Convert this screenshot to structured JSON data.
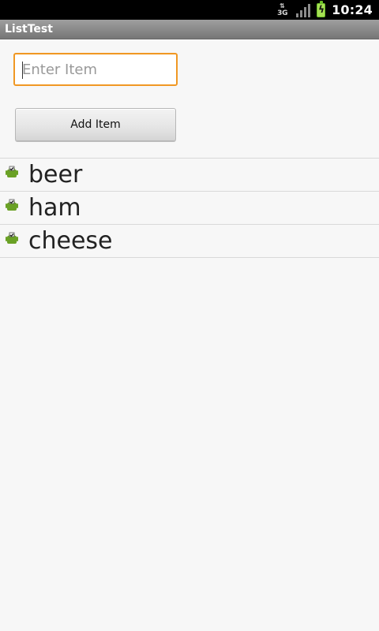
{
  "status_bar": {
    "network_label": "3G",
    "time": "10:24",
    "icons": [
      "network-3g-icon",
      "signal-strength-icon",
      "battery-charging-icon"
    ]
  },
  "app": {
    "title": "ListTest"
  },
  "form": {
    "input_value": "",
    "input_placeholder": "Enter Item",
    "button_label": "Add Item",
    "input_focus_color": "#f09824"
  },
  "list": {
    "items": [
      {
        "label": "beer",
        "icon": "android-check-icon"
      },
      {
        "label": "ham",
        "icon": "android-check-icon"
      },
      {
        "label": "cheese",
        "icon": "android-check-icon"
      }
    ]
  },
  "colors": {
    "background": "#f7f7f7",
    "status_bar": "#000000",
    "title_bar": "#858585",
    "battery": "#a6df54"
  }
}
